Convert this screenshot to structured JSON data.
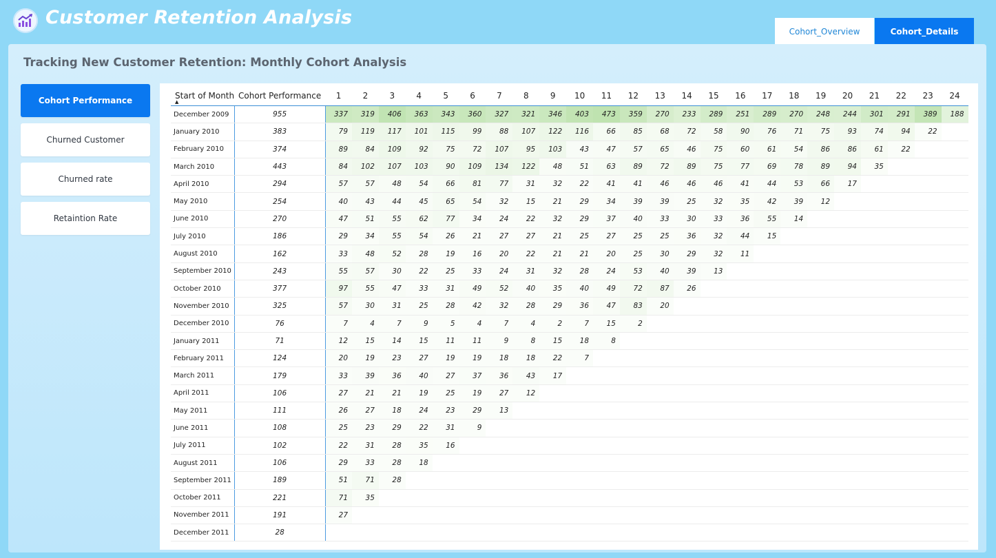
{
  "app": {
    "title": "Customer Retention Analysis"
  },
  "tabs": [
    {
      "label": "Cohort_Overview"
    },
    {
      "label": "Cohort_Details"
    }
  ],
  "subtitle": "Tracking New Customer Retention: Monthly Cohort Analysis",
  "sidebar": {
    "buttons": [
      {
        "label": "Cohort Performance"
      },
      {
        "label": "Churned Customer"
      },
      {
        "label": "Churned rate"
      },
      {
        "label": "Retaintion Rate"
      }
    ]
  },
  "colors": {
    "accent": "#0a78f0",
    "heat": "#c8e8c0",
    "background": "#8fd8f7"
  },
  "icons": {
    "logo": "trending-chart-icon",
    "sort": "sort-ascending-icon"
  },
  "table": {
    "header_month": "Start of Month",
    "header_perf": "Cohort Performance",
    "columns": [
      "1",
      "2",
      "3",
      "4",
      "5",
      "6",
      "7",
      "8",
      "9",
      "10",
      "11",
      "12",
      "13",
      "14",
      "15",
      "16",
      "17",
      "18",
      "19",
      "20",
      "21",
      "22",
      "23",
      "24"
    ],
    "rows": [
      {
        "month": "December 2009",
        "perf": "955",
        "values": [
          "337",
          "319",
          "406",
          "363",
          "343",
          "360",
          "327",
          "321",
          "346",
          "403",
          "473",
          "359",
          "270",
          "233",
          "289",
          "251",
          "289",
          "270",
          "248",
          "244",
          "301",
          "291",
          "389",
          "188"
        ]
      },
      {
        "month": "January 2010",
        "perf": "383",
        "values": [
          "79",
          "119",
          "117",
          "101",
          "115",
          "99",
          "88",
          "107",
          "122",
          "116",
          "66",
          "85",
          "68",
          "72",
          "58",
          "90",
          "76",
          "71",
          "75",
          "93",
          "74",
          "94",
          "22"
        ]
      },
      {
        "month": "February 2010",
        "perf": "374",
        "values": [
          "89",
          "84",
          "109",
          "92",
          "75",
          "72",
          "107",
          "95",
          "103",
          "43",
          "47",
          "57",
          "65",
          "46",
          "75",
          "60",
          "61",
          "54",
          "86",
          "86",
          "61",
          "22"
        ]
      },
      {
        "month": "March 2010",
        "perf": "443",
        "values": [
          "84",
          "102",
          "107",
          "103",
          "90",
          "109",
          "134",
          "122",
          "48",
          "51",
          "63",
          "89",
          "72",
          "89",
          "75",
          "77",
          "69",
          "78",
          "89",
          "94",
          "35"
        ]
      },
      {
        "month": "April 2010",
        "perf": "294",
        "values": [
          "57",
          "57",
          "48",
          "54",
          "66",
          "81",
          "77",
          "31",
          "32",
          "22",
          "41",
          "41",
          "46",
          "46",
          "46",
          "41",
          "44",
          "53",
          "66",
          "17"
        ]
      },
      {
        "month": "May 2010",
        "perf": "254",
        "values": [
          "40",
          "43",
          "44",
          "45",
          "65",
          "54",
          "32",
          "15",
          "21",
          "29",
          "34",
          "39",
          "39",
          "25",
          "32",
          "35",
          "42",
          "39",
          "12"
        ]
      },
      {
        "month": "June 2010",
        "perf": "270",
        "values": [
          "47",
          "51",
          "55",
          "62",
          "77",
          "34",
          "24",
          "22",
          "32",
          "29",
          "37",
          "40",
          "33",
          "30",
          "33",
          "36",
          "55",
          "14"
        ]
      },
      {
        "month": "July 2010",
        "perf": "186",
        "values": [
          "29",
          "34",
          "55",
          "54",
          "26",
          "21",
          "27",
          "27",
          "21",
          "25",
          "27",
          "25",
          "25",
          "36",
          "32",
          "44",
          "15"
        ]
      },
      {
        "month": "August 2010",
        "perf": "162",
        "values": [
          "33",
          "48",
          "52",
          "28",
          "19",
          "16",
          "20",
          "22",
          "21",
          "21",
          "20",
          "25",
          "30",
          "29",
          "32",
          "11"
        ]
      },
      {
        "month": "September 2010",
        "perf": "243",
        "values": [
          "55",
          "57",
          "30",
          "22",
          "25",
          "33",
          "24",
          "31",
          "32",
          "28",
          "24",
          "53",
          "40",
          "39",
          "13"
        ]
      },
      {
        "month": "October 2010",
        "perf": "377",
        "values": [
          "97",
          "55",
          "47",
          "33",
          "31",
          "49",
          "52",
          "40",
          "35",
          "40",
          "49",
          "72",
          "87",
          "26"
        ]
      },
      {
        "month": "November 2010",
        "perf": "325",
        "values": [
          "57",
          "30",
          "31",
          "25",
          "28",
          "42",
          "32",
          "28",
          "29",
          "36",
          "47",
          "83",
          "20"
        ]
      },
      {
        "month": "December 2010",
        "perf": "76",
        "values": [
          "7",
          "4",
          "7",
          "9",
          "5",
          "4",
          "7",
          "4",
          "2",
          "7",
          "15",
          "2"
        ]
      },
      {
        "month": "January 2011",
        "perf": "71",
        "values": [
          "12",
          "15",
          "14",
          "15",
          "11",
          "11",
          "9",
          "8",
          "15",
          "18",
          "8"
        ]
      },
      {
        "month": "February 2011",
        "perf": "124",
        "values": [
          "20",
          "19",
          "23",
          "27",
          "19",
          "19",
          "18",
          "18",
          "22",
          "7"
        ]
      },
      {
        "month": "March 2011",
        "perf": "179",
        "values": [
          "33",
          "39",
          "36",
          "40",
          "27",
          "37",
          "36",
          "43",
          "17"
        ]
      },
      {
        "month": "April 2011",
        "perf": "106",
        "values": [
          "27",
          "21",
          "21",
          "19",
          "25",
          "19",
          "27",
          "12"
        ]
      },
      {
        "month": "May 2011",
        "perf": "111",
        "values": [
          "26",
          "27",
          "18",
          "24",
          "23",
          "29",
          "13"
        ]
      },
      {
        "month": "June 2011",
        "perf": "108",
        "values": [
          "25",
          "23",
          "29",
          "22",
          "31",
          "9"
        ]
      },
      {
        "month": "July 2011",
        "perf": "102",
        "values": [
          "22",
          "31",
          "28",
          "35",
          "16"
        ]
      },
      {
        "month": "August 2011",
        "perf": "106",
        "values": [
          "29",
          "33",
          "28",
          "18"
        ]
      },
      {
        "month": "September 2011",
        "perf": "189",
        "values": [
          "51",
          "71",
          "28"
        ]
      },
      {
        "month": "October 2011",
        "perf": "221",
        "values": [
          "71",
          "35"
        ]
      },
      {
        "month": "November 2011",
        "perf": "191",
        "values": [
          "27"
        ]
      },
      {
        "month": "December 2011",
        "perf": "28",
        "values": []
      }
    ]
  }
}
